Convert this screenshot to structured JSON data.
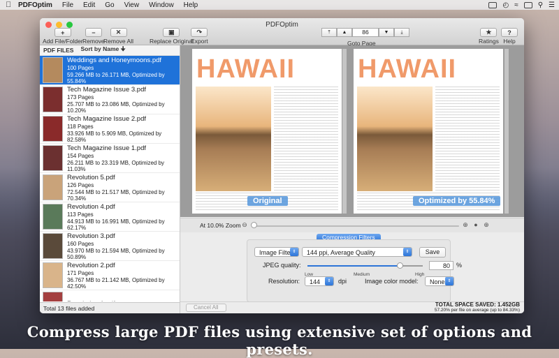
{
  "menubar": {
    "app_name": "PDFOptim",
    "items": [
      "File",
      "Edit",
      "Go",
      "View",
      "Window",
      "Help"
    ]
  },
  "window": {
    "title": "PDFOptim"
  },
  "toolbar": {
    "add_label": "Add File/Folder",
    "remove_label": "Remove",
    "remove_all_label": "Remove All",
    "replace_label": "Replace Original",
    "export_label": "Export",
    "goto_label": "Goto Page",
    "page_number": "86",
    "ratings_label": "Ratings",
    "help_label": "Help"
  },
  "sidebar": {
    "header_files": "PDF FILES",
    "header_sort": "Sort by Name",
    "files": [
      {
        "name": "Weddings and Honeymoons.pdf",
        "pages": "100 Pages",
        "size": "59.266 MB to 26.171 MB, Optimized by 55.84%",
        "selected": true,
        "thumb": "#b48a5e"
      },
      {
        "name": "Tech Magazine Issue 3.pdf",
        "pages": "173 Pages",
        "size": "25.707 MB to 23.086 MB, Optimized by 10.20%",
        "selected": false,
        "thumb": "#7b2e2e"
      },
      {
        "name": "Tech Magazine Issue 2.pdf",
        "pages": "118 Pages",
        "size": "33.926 MB to 5.909 MB, Optimized by 82.58%",
        "selected": false,
        "thumb": "#8a2a2a"
      },
      {
        "name": "Tech Magazine Issue 1.pdf",
        "pages": "154 Pages",
        "size": "26.211 MB to 23.319 MB, Optimized by 11.03%",
        "selected": false,
        "thumb": "#6b3030"
      },
      {
        "name": "Revolution 5.pdf",
        "pages": "126 Pages",
        "size": "72.544 MB to 21.517 MB, Optimized by 70.34%",
        "selected": false,
        "thumb": "#c9a37a"
      },
      {
        "name": "Revolution 4.pdf",
        "pages": "113 Pages",
        "size": "44.913 MB to 16.991 MB, Optimized by 62.17%",
        "selected": false,
        "thumb": "#5a7a5a"
      },
      {
        "name": "Revolution 3.pdf",
        "pages": "160 Pages",
        "size": "43.970 MB to 21.594 MB, Optimized by 50.89%",
        "selected": false,
        "thumb": "#5a4a3a"
      },
      {
        "name": "Revolution 2.pdf",
        "pages": "171 Pages",
        "size": "36.767 MB to 21.142 MB, Optimized by 42.50%",
        "selected": false,
        "thumb": "#d9b48a"
      },
      {
        "name": "Revolution 1.pdf",
        "pages": "",
        "size": "",
        "selected": false,
        "thumb": "#a44040"
      }
    ],
    "footer": "Total 13 files added"
  },
  "preview": {
    "title_text": "HAWAII",
    "left_label": "Original",
    "right_label": "Optimized by 55.84%"
  },
  "zoom": {
    "label": "At 10.0% Zoom",
    "level": 0.0
  },
  "compression": {
    "tab_label": "Compression Filters",
    "filter_select": "Image Filter",
    "preset_select": "144 ppi, Average Quality",
    "save_label": "Save",
    "jpeg_label": "JPEG quality:",
    "jpeg_value": "80",
    "jpeg_unit": "%",
    "jpeg_level": 0.8,
    "tick_low": "Low",
    "tick_medium": "Medium",
    "tick_high": "High",
    "resolution_label": "Resolution:",
    "resolution_value": "144",
    "resolution_unit": "dpi",
    "color_label": "Image color model:",
    "color_value": "None"
  },
  "status": {
    "cancel_label": "Cancel All",
    "total_saved": "TOTAL SPACE SAVED: 1.452GB",
    "per_file": "57.20% per file on average (up to 84.33%)"
  },
  "caption": "Compress large PDF files using extensive set of options and presets.",
  "colors": {
    "accent": "#1f72d9",
    "hawaii": "#f09a6a"
  }
}
